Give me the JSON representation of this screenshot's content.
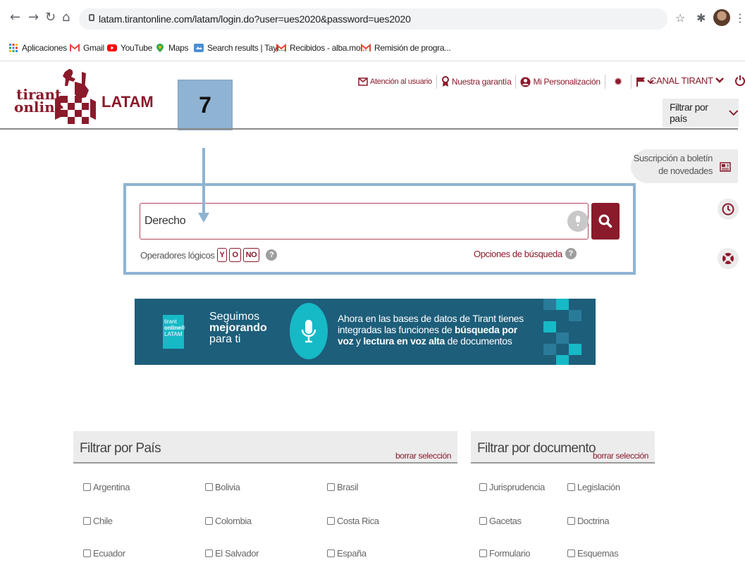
{
  "browser": {
    "url": "latam.tirantonline.com/latam/login.do?user=ues2020&password=ues2020",
    "bookmarks": [
      {
        "label": "Aplicaciones",
        "icon": "apps-grid-icon"
      },
      {
        "label": "Gmail",
        "icon": "gmail-icon"
      },
      {
        "label": "YouTube",
        "icon": "youtube-icon"
      },
      {
        "label": "Maps",
        "icon": "maps-icon"
      },
      {
        "label": "Search results | Tayl...",
        "icon": "search-results-icon"
      },
      {
        "label": "Recibidos - alba.mo...",
        "icon": "gmail-icon"
      },
      {
        "label": "Remisión de progra...",
        "icon": "gmail-icon"
      }
    ]
  },
  "header": {
    "logo_line1": "tirant",
    "logo_line2": "online",
    "logo_region": "LATAM",
    "callout_number": "7",
    "links": {
      "support": "Atención al usuario",
      "guarantee": "Nuestra garantía",
      "personalization": "Mi Personalización",
      "account": "CANAL TIRANT"
    },
    "filter_country_button": "Filtrar por país"
  },
  "sidebar": {
    "newsletter_line1": "Suscripción a boletín",
    "newsletter_line2": "de novedades"
  },
  "search": {
    "value": "Derecho",
    "operators_label": "Operadores lógicos",
    "operators": [
      "Y",
      "O",
      "NO"
    ],
    "options_label": "Opciones de búsqueda"
  },
  "banner": {
    "logo_lines": [
      "tirant",
      "online®",
      "LATAM"
    ],
    "headline_1": "Seguimos",
    "headline_2": "mejorando",
    "headline_3": "para ti",
    "text_1": "Ahora en las bases de datos de Tirant tienes",
    "text_2a": "integradas las funciones de ",
    "text_2b": "búsqueda por",
    "text_3a": "voz",
    "text_3b": " y ",
    "text_3c": "lectura en voz alta",
    "text_3d": " de documentos"
  },
  "filter_country": {
    "title": "Filtrar por País",
    "clear": "borrar selección",
    "options": [
      "Argentina",
      "Bolivia",
      "Brasil",
      "Chile",
      "Colombia",
      "Costa Rica",
      "Ecuador",
      "El Salvador",
      "España"
    ]
  },
  "filter_document": {
    "title": "Filtrar por documento",
    "clear": "borrar selección",
    "options": [
      "Jurisprudencia",
      "Legislación",
      "Gacetas",
      "Doctrina",
      "Formulario",
      "Esquemas"
    ]
  },
  "colors": {
    "brand": "#8b1a2b",
    "callout": "#8fb3d2",
    "banner_bg": "#1d5e7a",
    "banner_accent": "#16b9c6"
  }
}
